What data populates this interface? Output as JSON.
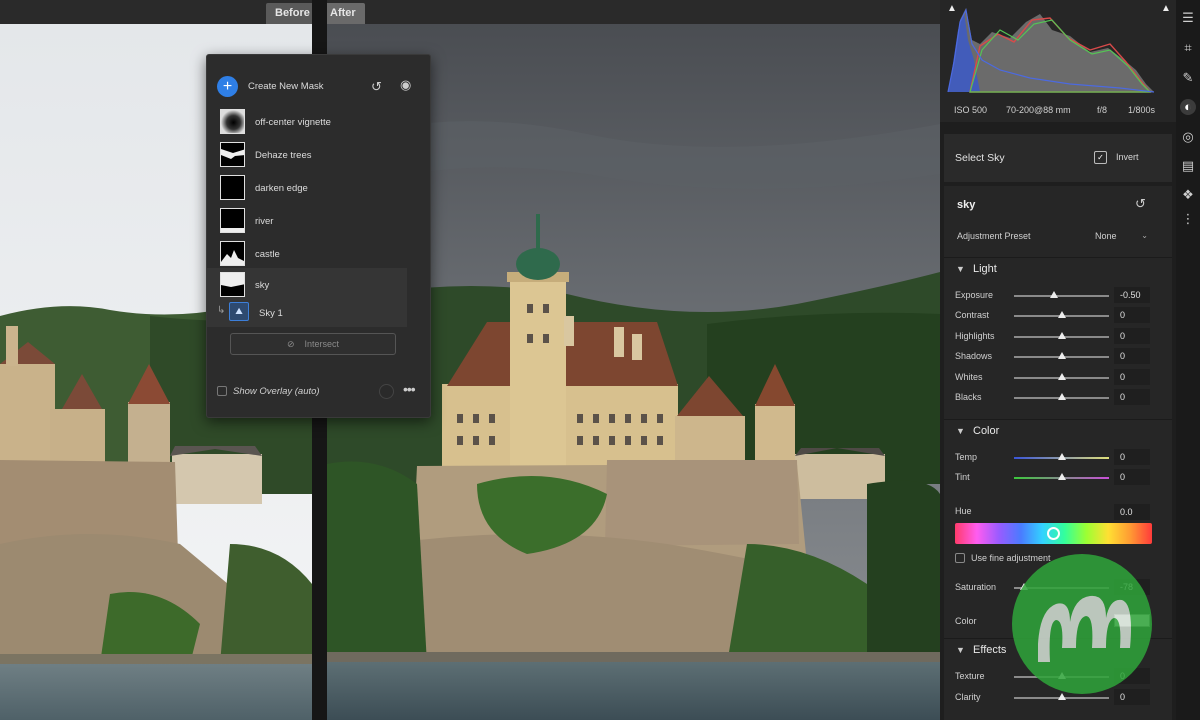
{
  "compare": {
    "before_label": "Before",
    "after_label": "After"
  },
  "masks_panel": {
    "create_label": "Create New Mask",
    "masks": [
      {
        "name": "off-center vignette",
        "thumb": "vignette"
      },
      {
        "name": "Dehaze trees",
        "thumb": "trees"
      },
      {
        "name": "darken edge",
        "thumb": "black"
      },
      {
        "name": "river",
        "thumb": "river"
      },
      {
        "name": "castle",
        "thumb": "castle"
      },
      {
        "name": "sky",
        "thumb": "sky",
        "selected": true
      }
    ],
    "sub_component": {
      "label": "Sky 1",
      "icon": "sky-selection-icon"
    },
    "intersect_label": "Intersect",
    "overlay_label": "Show Overlay (auto)",
    "overlay_color": "#2a2a2a"
  },
  "histogram": {
    "exif": {
      "iso": "ISO 500",
      "lens": "70-200@88 mm",
      "aperture": "f/8",
      "shutter": "1/800s"
    }
  },
  "selection": {
    "title": "Select Sky",
    "invert_label": "Invert"
  },
  "adjustments": {
    "mask_name": "sky",
    "preset_label": "Adjustment Preset",
    "preset_value": "None",
    "light": {
      "title": "Light",
      "sliders": [
        {
          "label": "Exposure",
          "value": "-0.50",
          "level": 0.42
        },
        {
          "label": "Contrast",
          "value": "0",
          "level": 0.5
        },
        {
          "label": "Highlights",
          "value": "0",
          "level": 0.5
        },
        {
          "label": "Shadows",
          "value": "0",
          "level": 0.5
        },
        {
          "label": "Whites",
          "value": "0",
          "level": 0.5
        },
        {
          "label": "Blacks",
          "value": "0",
          "level": 0.5
        }
      ]
    },
    "color": {
      "title": "Color",
      "sliders": [
        {
          "label": "Temp",
          "value": "0",
          "level": 0.5
        },
        {
          "label": "Tint",
          "value": "0",
          "level": 0.5
        }
      ],
      "hue_label": "Hue",
      "hue_value": "0.0",
      "fine_adjust_label": "Use fine adjustment",
      "saturation": {
        "label": "Saturation",
        "value": "-78",
        "level": 0.11
      },
      "color_label": "Color"
    },
    "effects": {
      "title": "Effects",
      "sliders": [
        {
          "label": "Texture",
          "value": "0",
          "level": 0.5
        },
        {
          "label": "Clarity",
          "value": "0",
          "level": 0.5
        }
      ]
    }
  },
  "tools": [
    "sliders-icon",
    "crop-icon",
    "healing-brush-icon",
    "masking-icon",
    "red-eye-icon",
    "presets-icon",
    "versions-icon",
    "more-icon"
  ]
}
